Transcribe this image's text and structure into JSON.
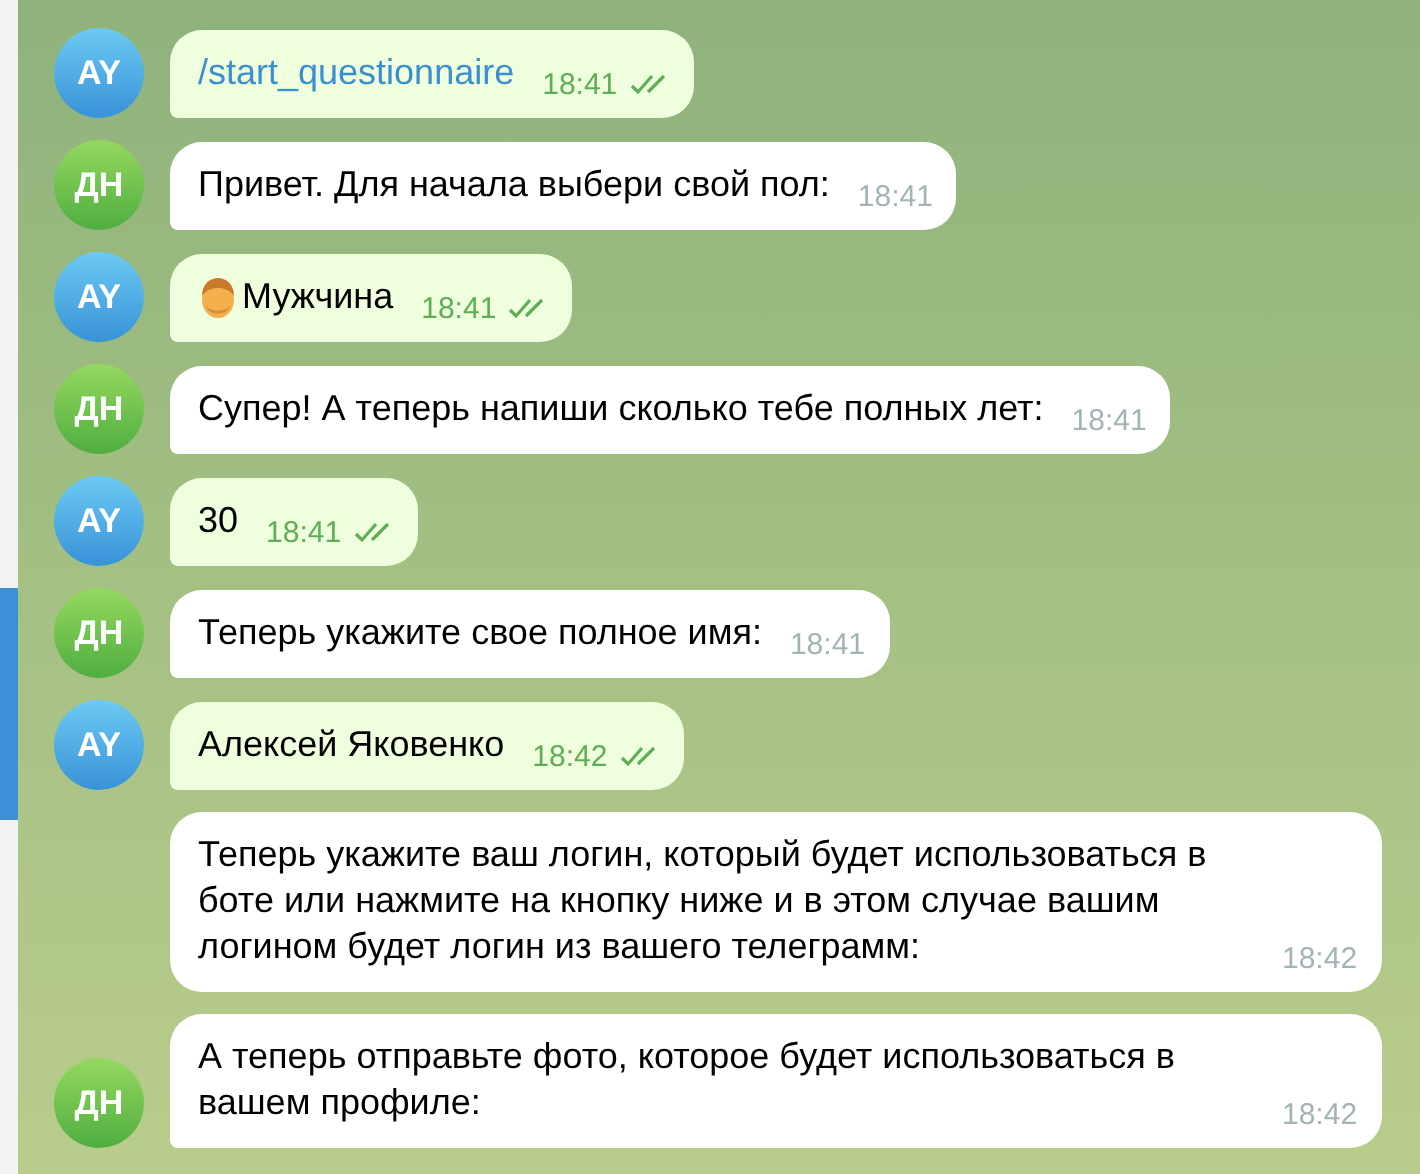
{
  "messages": [
    {
      "outgoing": true,
      "avatar": "AY",
      "kind": "command",
      "text": "/start_questionnaire",
      "time": "18:41",
      "read": true,
      "tail": true
    },
    {
      "outgoing": false,
      "avatar": "ДН",
      "kind": "text",
      "text": "Привет. Для начала выбери свой пол:",
      "time": "18:41",
      "tail": true
    },
    {
      "outgoing": true,
      "avatar": "AY",
      "kind": "emoji_text",
      "text": "Мужчина",
      "time": "18:41",
      "read": true,
      "tail": true
    },
    {
      "outgoing": false,
      "avatar": "ДН",
      "kind": "text",
      "text": "Супер! А теперь напиши сколько тебе полных лет:",
      "time": "18:41",
      "tail": true
    },
    {
      "outgoing": true,
      "avatar": "AY",
      "kind": "text",
      "text": "30",
      "time": "18:41",
      "read": true,
      "tail": true
    },
    {
      "outgoing": false,
      "avatar": "ДН",
      "kind": "text",
      "text": "Теперь укажите свое полное имя:",
      "time": "18:41",
      "tail": true
    },
    {
      "outgoing": true,
      "avatar": "AY",
      "kind": "text",
      "text": "Алексей Яковенко",
      "time": "18:42",
      "read": true,
      "tail": true
    },
    {
      "outgoing": false,
      "kind": "text",
      "text": "Теперь укажите ваш логин, который будет использоваться в боте или нажмите на кнопку ниже и в этом случае вашим логином будет логин из вашего телеграмм:",
      "time": "18:42",
      "tail": false
    },
    {
      "outgoing": false,
      "avatar": "ДН",
      "kind": "text",
      "text": "А теперь отправьте фото, которое будет использоваться в вашем профиле:",
      "time": "18:42",
      "tail": true
    }
  ]
}
